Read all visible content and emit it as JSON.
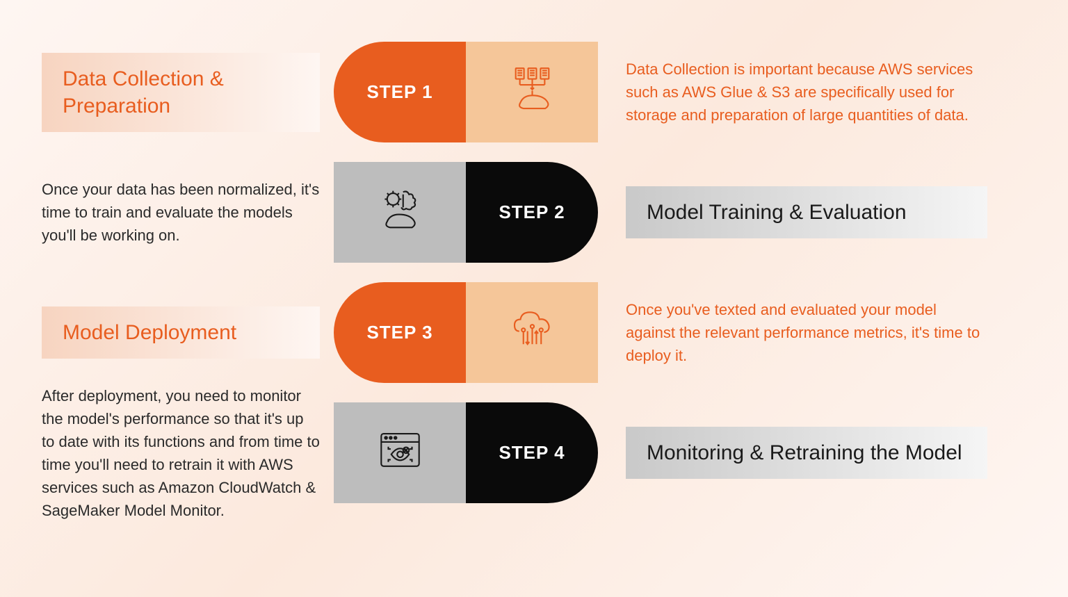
{
  "steps": [
    {
      "label": "STEP 1",
      "title": "Data Collection & Preparation",
      "description": "Data Collection is important because AWS services such as AWS Glue & S3 are specifically used for storage and preparation of large quantities of data."
    },
    {
      "label": "STEP 2",
      "title": "Model Training & Evaluation",
      "description": "Once your data has been normalized, it's time to train and evaluate the models you'll be working on."
    },
    {
      "label": "STEP 3",
      "title": "Model Deployment",
      "description": "Once you've texted and evaluated your model against the relevant performance metrics, it's time to deploy it."
    },
    {
      "label": "STEP 4",
      "title": "Monitoring & Retraining the Model",
      "description": "After deployment, you need to monitor the model's performance so that it's up to date with its functions and from time to time you'll need to retrain it with AWS services such as Amazon CloudWatch & SageMaker Model Monitor."
    }
  ],
  "colors": {
    "orange": "#e85d1f",
    "peach": "#f5c699",
    "gray": "#bdbdbd",
    "black": "#0a0a0a"
  }
}
